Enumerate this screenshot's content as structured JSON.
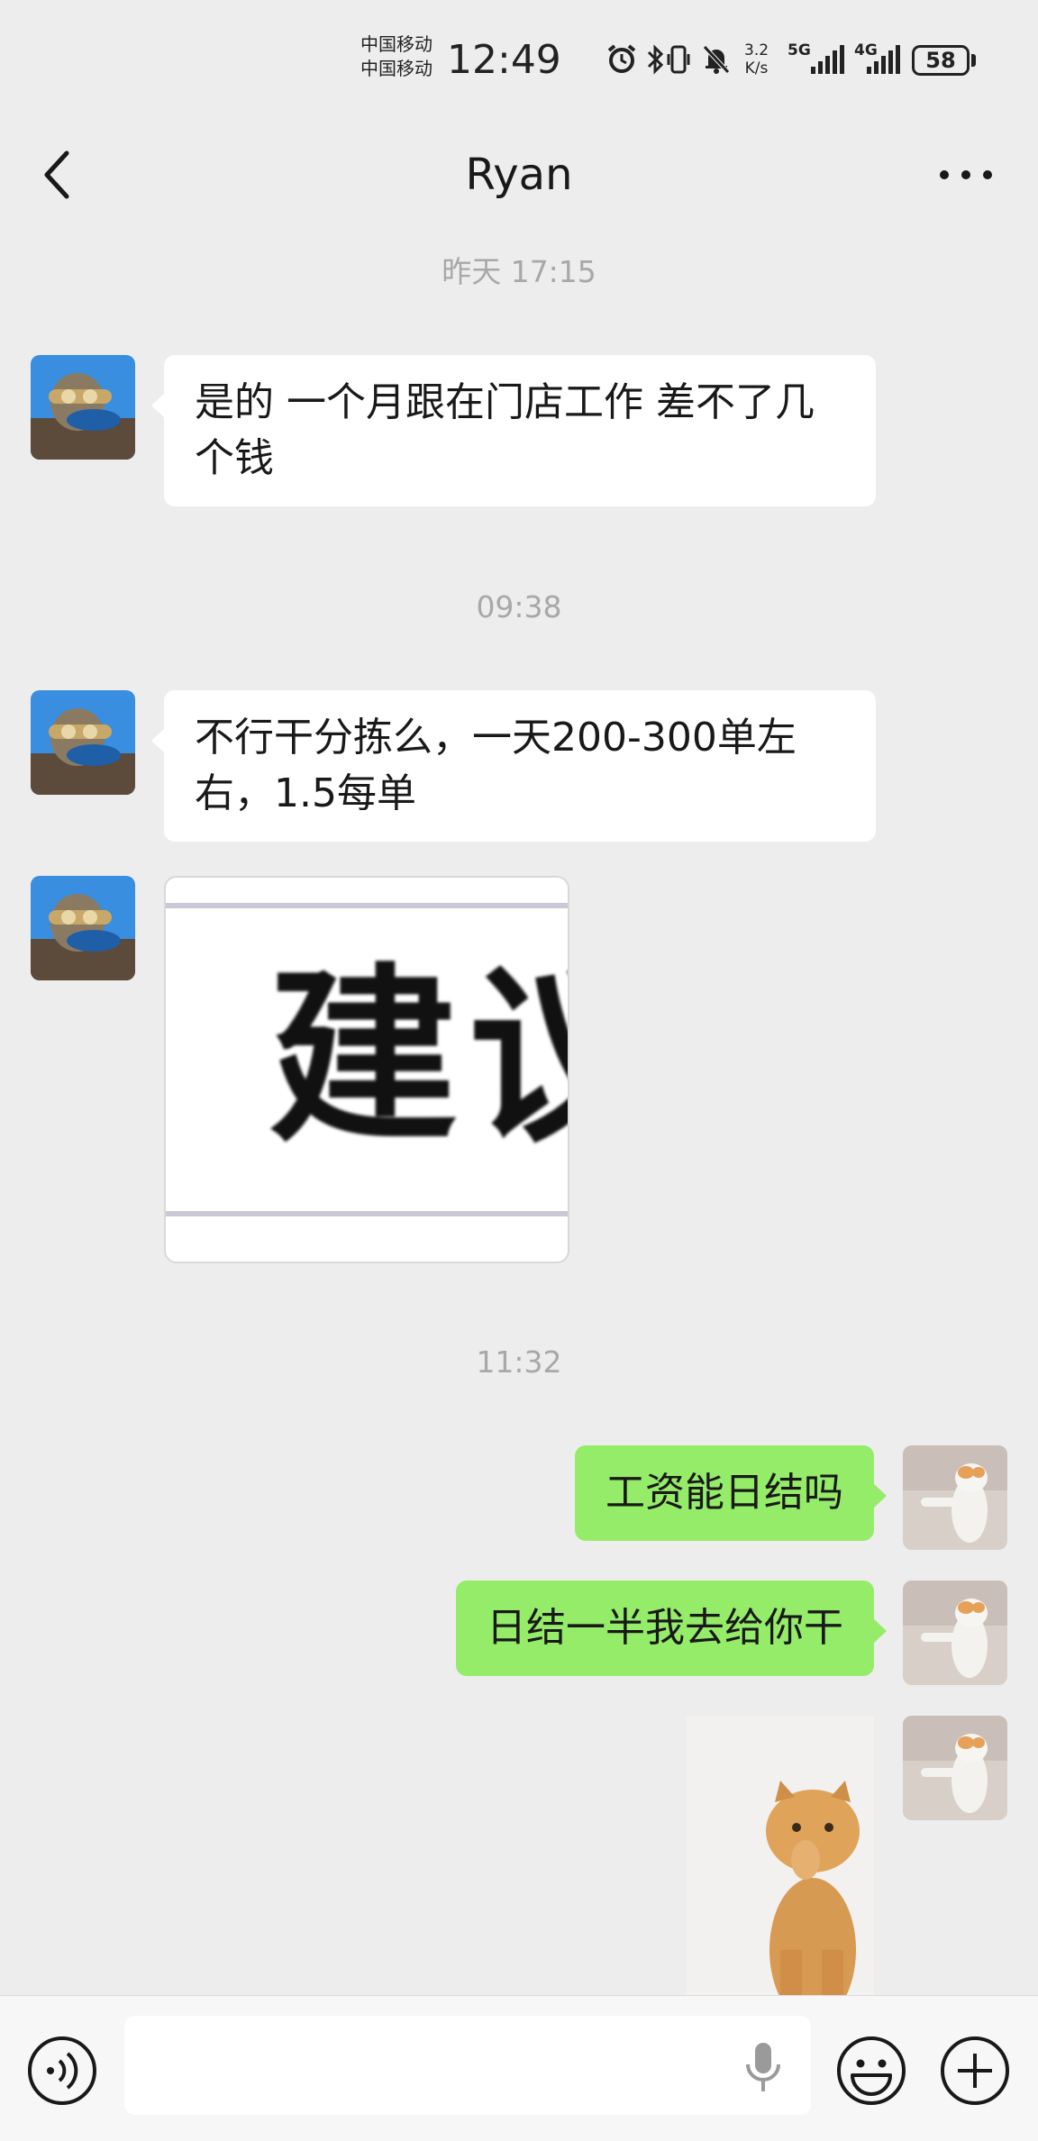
{
  "status_bar": {
    "carrier_1": "中国移动",
    "carrier_2": "中国移动",
    "time": "12:49",
    "speed_value": "3.2",
    "speed_unit": "K/s",
    "net_1": "5G",
    "net_2": "4G",
    "battery": "58"
  },
  "header": {
    "title": "Ryan"
  },
  "messages": {
    "time_1": "昨天 17:15",
    "msg_1": "是的  一个月跟在门店工作 差不了几个钱",
    "time_2": "09:38",
    "msg_2": "不行干分拣么，一天200-300单左右，1.5每单",
    "img_text": "建议",
    "time_3": "11:32",
    "msg_3": "工资能日结吗",
    "msg_4": "日结一半我去给你干"
  },
  "input": {
    "value": "",
    "placeholder": ""
  },
  "colors": {
    "background": "#ededed",
    "bubble_incoming": "#ffffff",
    "bubble_outgoing": "#95ec69",
    "timestamp_text": "#a8a8a8"
  },
  "icons": {
    "back": "chevron-left-icon",
    "more": "more-dots-icon",
    "voice": "voice-icon",
    "mic": "microphone-icon",
    "emoji": "emoji-icon",
    "plus": "plus-icon"
  }
}
